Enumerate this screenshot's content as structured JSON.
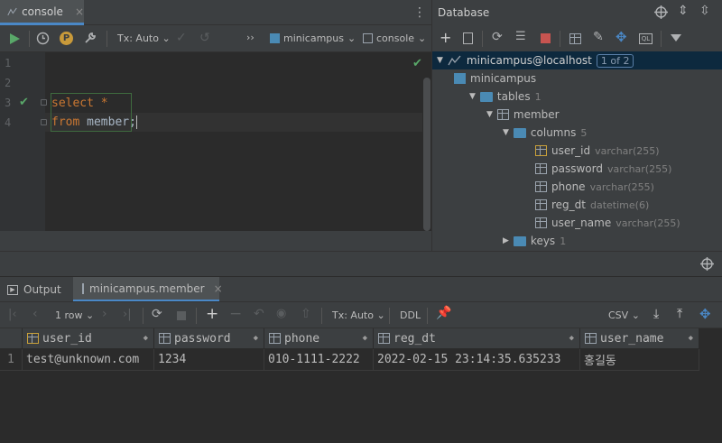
{
  "editor": {
    "tab_title": "console",
    "tx_label": "Tx: Auto",
    "more_label": "››",
    "schema_label": "minicampus",
    "console_label": "console",
    "line_numbers": [
      "1",
      "2",
      "3",
      "4"
    ],
    "code": [
      {
        "kw": "select",
        "rest": " *",
        "rest_is_kw": true
      },
      {
        "kw": "from",
        "rest": " member;",
        "rest_is_kw": false
      }
    ]
  },
  "database": {
    "title": "Database",
    "tree": {
      "connection": "minicampus@localhost",
      "connection_badge": "1 of 2",
      "schema": "minicampus",
      "tables_label": "tables",
      "tables_count": "1",
      "table": "member",
      "columns_label": "columns",
      "columns_count": "5",
      "columns": [
        {
          "name": "user_id",
          "type": "varchar(255)"
        },
        {
          "name": "password",
          "type": "varchar(255)"
        },
        {
          "name": "phone",
          "type": "varchar(255)"
        },
        {
          "name": "reg_dt",
          "type": "datetime(6)"
        },
        {
          "name": "user_name",
          "type": "varchar(255)"
        }
      ],
      "keys_label": "keys",
      "keys_count": "1"
    }
  },
  "results": {
    "tabs": [
      "Output",
      "minicampus.member"
    ],
    "rows_label": "1 row",
    "tx_label": "Tx: Auto",
    "ddl_label": "DDL",
    "csv_label": "CSV",
    "headers": [
      "user_id",
      "password",
      "phone",
      "reg_dt",
      "user_name"
    ],
    "rows": [
      {
        "num": "1",
        "cells": [
          "test@unknown.com",
          "1234",
          "010-1111-2222",
          "2022-02-15 23:14:35.635233",
          "홍길동"
        ]
      }
    ]
  },
  "colors": {
    "accent": "#4a88c7",
    "run_green": "#59a869",
    "keyword": "#cc7832",
    "stop_red": "#c75450"
  }
}
